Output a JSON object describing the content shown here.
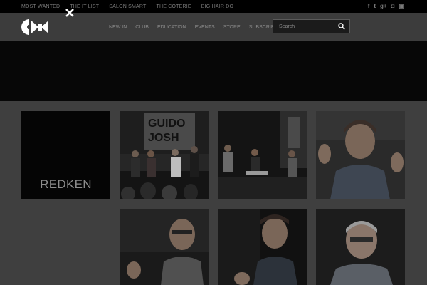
{
  "topnav": [
    "MOST WANTED",
    "THE IT LIST",
    "SALON SMART",
    "THE COTERIE",
    "BIG HAIR DO"
  ],
  "social_icons": [
    "facebook-icon",
    "twitter-icon",
    "google-plus-icon",
    "instagram-icon",
    "youtube-icon"
  ],
  "social_glyphs": {
    "facebook": "f",
    "twitter": "t",
    "google_plus": "g+",
    "instagram": "◘",
    "youtube": "▣"
  },
  "mainnav": [
    "NEW IN",
    "CLUB",
    "EDUCATION",
    "EVENTS",
    "STORE",
    "SUBSCRIBE"
  ],
  "search": {
    "placeholder": "Search"
  },
  "brand_tile": {
    "label": "REDKEN"
  },
  "photo_sign": {
    "line1": "GUIDO",
    "line2": "JOSH"
  },
  "colors": {
    "overlay_bg": "#3f3f3f",
    "topbar": "#000000",
    "banner": "#070707",
    "tile": "#050505"
  }
}
